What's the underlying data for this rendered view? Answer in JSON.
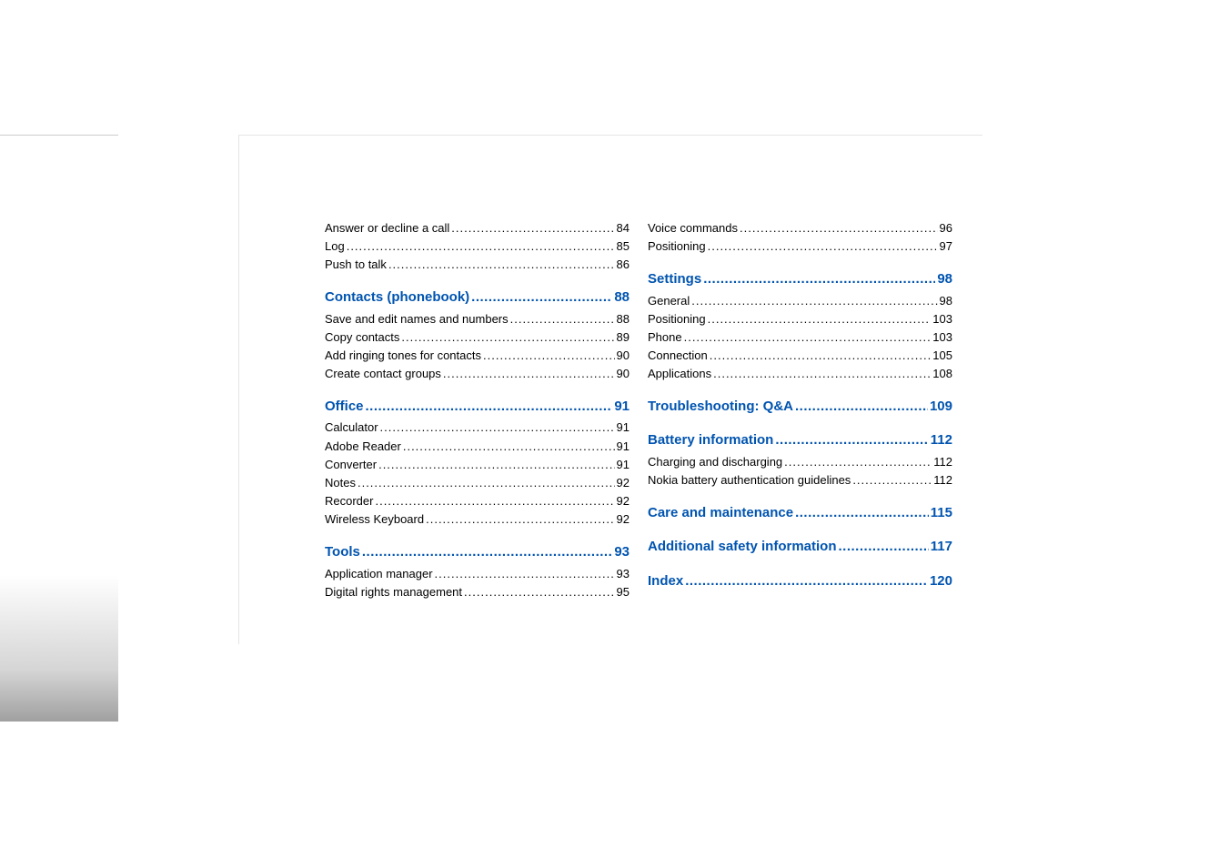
{
  "left_column": [
    {
      "type": "item",
      "label": "Answer or decline a call",
      "page": "84"
    },
    {
      "type": "item",
      "label": "Log",
      "page": "85"
    },
    {
      "type": "item",
      "label": "Push to talk",
      "page": "86"
    },
    {
      "type": "section",
      "label": "Contacts (phonebook)",
      "page": "88"
    },
    {
      "type": "item",
      "label": "Save and edit names and numbers",
      "page": "88"
    },
    {
      "type": "item",
      "label": "Copy contacts",
      "page": "89"
    },
    {
      "type": "item",
      "label": "Add ringing tones for contacts",
      "page": "90"
    },
    {
      "type": "item",
      "label": "Create contact groups",
      "page": "90"
    },
    {
      "type": "section",
      "label": "Office",
      "page": "91"
    },
    {
      "type": "item",
      "label": "Calculator",
      "page": "91"
    },
    {
      "type": "item",
      "label": "Adobe Reader",
      "page": "91"
    },
    {
      "type": "item",
      "label": "Converter",
      "page": "91"
    },
    {
      "type": "item",
      "label": "Notes",
      "page": "92"
    },
    {
      "type": "item",
      "label": "Recorder",
      "page": "92"
    },
    {
      "type": "item",
      "label": "Wireless Keyboard",
      "page": "92"
    },
    {
      "type": "section",
      "label": "Tools",
      "page": "93"
    },
    {
      "type": "item",
      "label": "Application manager",
      "page": "93"
    },
    {
      "type": "item",
      "label": "Digital rights management",
      "page": "95"
    }
  ],
  "right_column": [
    {
      "type": "item",
      "label": "Voice commands",
      "page": "96"
    },
    {
      "type": "item",
      "label": "Positioning",
      "page": "97"
    },
    {
      "type": "section",
      "label": "Settings",
      "page": "98"
    },
    {
      "type": "item",
      "label": "General",
      "page": "98"
    },
    {
      "type": "item",
      "label": "Positioning",
      "page": "103"
    },
    {
      "type": "item",
      "label": "Phone",
      "page": "103"
    },
    {
      "type": "item",
      "label": "Connection",
      "page": "105"
    },
    {
      "type": "item",
      "label": "Applications",
      "page": "108"
    },
    {
      "type": "section",
      "label": "Troubleshooting: Q&A",
      "page": "109"
    },
    {
      "type": "section",
      "label": "Battery information",
      "page": "112"
    },
    {
      "type": "item",
      "label": "Charging and discharging",
      "page": "112"
    },
    {
      "type": "item",
      "label": "Nokia battery authentication guidelines",
      "page": "112"
    },
    {
      "type": "section",
      "label": "Care and maintenance",
      "page": "115"
    },
    {
      "type": "section",
      "label": "Additional safety information",
      "page": "117"
    },
    {
      "type": "section",
      "label": "Index",
      "page": "120"
    }
  ]
}
